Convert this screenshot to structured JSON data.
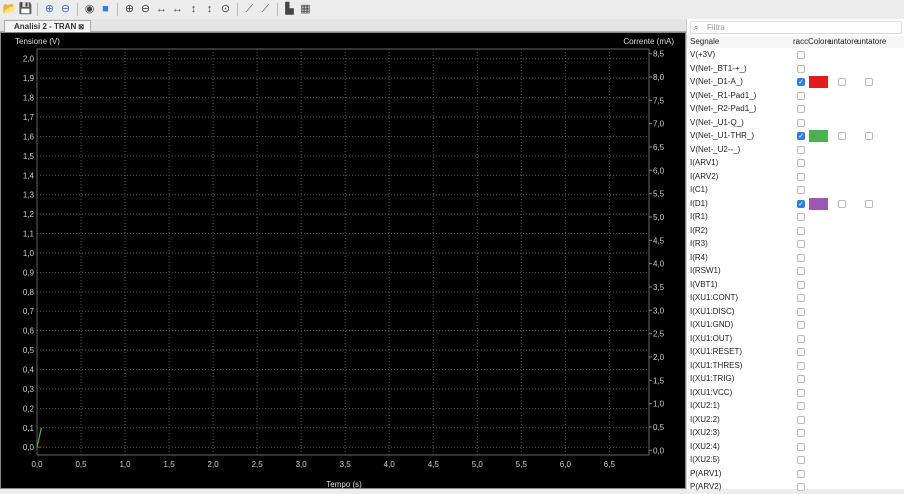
{
  "toolbar": {
    "icons": [
      "open-folder-icon",
      "save-icon",
      "add-signal-icon",
      "remove-signal-icon",
      "probe-icon",
      "tune-icon",
      "zoom-in-icon",
      "zoom-out-icon",
      "zoom-in-horizontal-icon",
      "zoom-out-horizontal-icon",
      "zoom-in-vertical-icon",
      "zoom-out-vertical-icon",
      "zoom-fit-icon",
      "cursor-icon",
      "probe-pen-icon",
      "plot-icon",
      "settings-icon"
    ]
  },
  "tab": {
    "label": "Analisi 2 - TRAN"
  },
  "plot": {
    "background": "#000000"
  },
  "chart_data": {
    "type": "line",
    "xlabel": "Tempo (s)",
    "ylabel": "Tensione (V)",
    "y2label": "Corrente (mA)",
    "xlim": [
      0,
      6.95
    ],
    "ylim": [
      -0.04,
      2.05
    ],
    "y2lim": [
      -0.1,
      8.6
    ],
    "grid": true,
    "xticks": [
      "0,0",
      "0,5",
      "1,0",
      "1,5",
      "2,0",
      "2,5",
      "3,0",
      "3,5",
      "4,0",
      "4,5",
      "5,0",
      "5,5",
      "6,0",
      "6,5"
    ],
    "yticks": [
      "0,0",
      "0,1",
      "0,2",
      "0,3",
      "0,4",
      "0,5",
      "0,6",
      "0,7",
      "0,8",
      "0,9",
      "1,0",
      "1,1",
      "1,2",
      "1,3",
      "1,4",
      "1,5",
      "1,6",
      "1,7",
      "1,8",
      "1,9",
      "2,0"
    ],
    "y2ticks": [
      "0,0",
      "0,5",
      "1,0",
      "1,5",
      "2,0",
      "2,5",
      "3,0",
      "3,5",
      "4,0",
      "4,5",
      "5,0",
      "5,5",
      "6,0",
      "6,5",
      "7,0",
      "7,5",
      "8,0",
      "8,5"
    ],
    "series": [
      {
        "signal": "V(Net-_D1-A_)",
        "color": "#e31a1c",
        "x": [
          0,
          0.05
        ],
        "y": [
          0,
          0
        ]
      },
      {
        "signal": "V(Net-_U1-THR_)",
        "color": "#4caf50",
        "x": [
          0,
          0.05
        ],
        "y": [
          0,
          0.1
        ]
      }
    ]
  },
  "sidebar": {
    "filter_placeholder": "Filtra",
    "headers": [
      "Segnale",
      "racc",
      "Colore",
      "untatore",
      "untatore"
    ],
    "signals": [
      {
        "name": "V(+3V)"
      },
      {
        "name": "V(Net-_BT1-+_)"
      },
      {
        "name": "V(Net-_D1-A_)",
        "checked": true,
        "color": "#e31a1c"
      },
      {
        "name": "V(Net-_R1-Pad1_)"
      },
      {
        "name": "V(Net-_R2-Pad1_)"
      },
      {
        "name": "V(Net-_U1-Q_)"
      },
      {
        "name": "V(Net-_U1-THR_)",
        "checked": true,
        "color": "#4caf50"
      },
      {
        "name": "V(Net-_U2--_)"
      },
      {
        "name": "I(ARV1)"
      },
      {
        "name": "I(ARV2)"
      },
      {
        "name": "I(C1)"
      },
      {
        "name": "I(D1)",
        "checked": true,
        "color": "#9b59b6"
      },
      {
        "name": "I(R1)"
      },
      {
        "name": "I(R2)"
      },
      {
        "name": "I(R3)"
      },
      {
        "name": "I(R4)"
      },
      {
        "name": "I(RSW1)"
      },
      {
        "name": "I(VBT1)"
      },
      {
        "name": "I(XU1:CONT)"
      },
      {
        "name": "I(XU1:DISC)"
      },
      {
        "name": "I(XU1:GND)"
      },
      {
        "name": "I(XU1:OUT)"
      },
      {
        "name": "I(XU1:RESET)"
      },
      {
        "name": "I(XU1:THRES)"
      },
      {
        "name": "I(XU1:TRIG)"
      },
      {
        "name": "I(XU1:VCC)"
      },
      {
        "name": "I(XU2:1)"
      },
      {
        "name": "I(XU2:2)"
      },
      {
        "name": "I(XU2:3)"
      },
      {
        "name": "I(XU2:4)"
      },
      {
        "name": "I(XU2:5)"
      },
      {
        "name": "P(ARV1)"
      },
      {
        "name": "P(ARV2)"
      }
    ]
  }
}
